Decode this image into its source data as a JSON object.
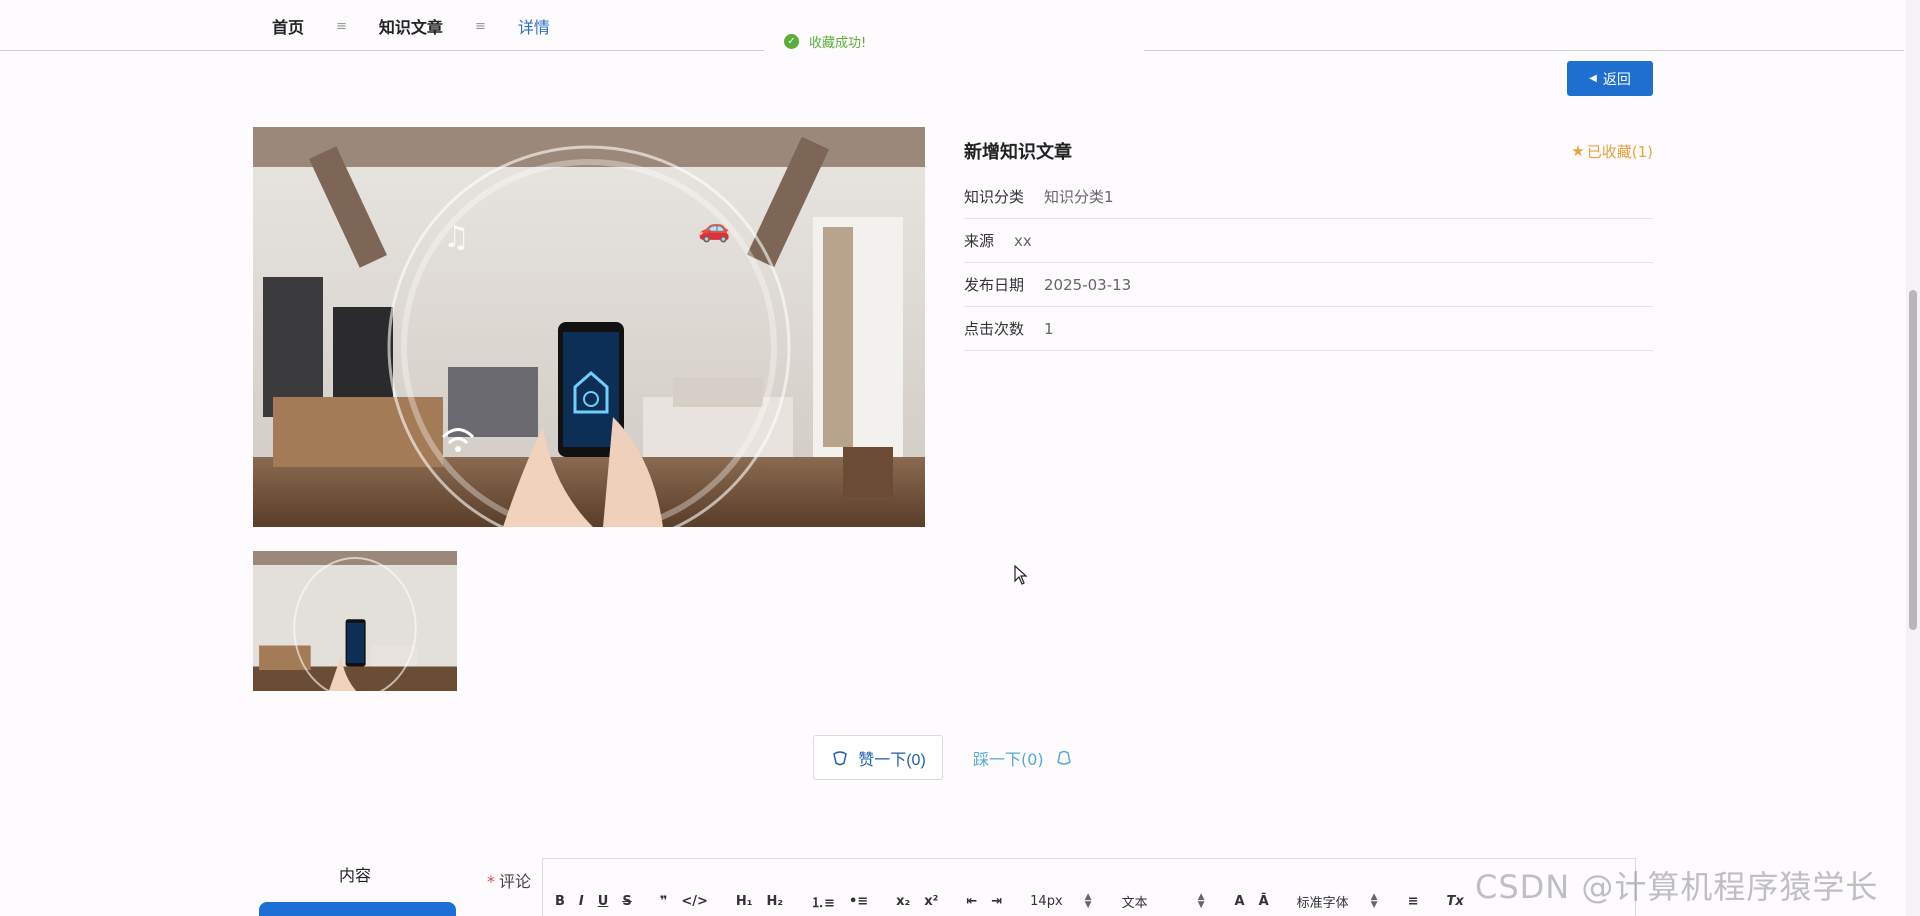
{
  "breadcrumb": {
    "items": [
      {
        "label": "首页"
      },
      {
        "label": "知识文章"
      },
      {
        "label": "详情"
      }
    ],
    "separator": "≡"
  },
  "toast": {
    "message": "收藏成功!"
  },
  "back_button": {
    "label": "返回"
  },
  "article": {
    "title": "新增知识文章",
    "favorite_label": "已收藏(1)",
    "fields": [
      {
        "key": "知识分类",
        "value": "知识分类1"
      },
      {
        "key": "来源",
        "value": "xx"
      },
      {
        "key": "发布日期",
        "value": "2025-03-13"
      },
      {
        "key": "点击次数",
        "value": "1"
      }
    ]
  },
  "actions": {
    "like_label": "赞一下(0)",
    "dislike_label": "踩一下(0)"
  },
  "content_tab": {
    "label": "内容"
  },
  "comment": {
    "required_mark": "*",
    "label": "评论",
    "toolbar": {
      "bold": "B",
      "italic": "I",
      "underline": "U",
      "strike": "S",
      "blockquote": "❞",
      "code": "</>",
      "h1": "H₁",
      "h2": "H₂",
      "ordered_list": "⒈≡",
      "bullet_list": "•≡",
      "subscript": "x₂",
      "superscript": "x²",
      "outdent": "⇤",
      "indent": "⇥",
      "font_size": "14px",
      "text_style": "文本",
      "font_color": "A",
      "background": "Ā",
      "font_family": "标准字体",
      "align": "≡",
      "clear_format": "Tx"
    }
  },
  "watermark": "CSDN @计算机程序猿学长",
  "colors": {
    "primary": "#1f6fd1",
    "favorite": "#e8a33b",
    "success": "#5bae3c",
    "link": "#2d6fc4"
  }
}
